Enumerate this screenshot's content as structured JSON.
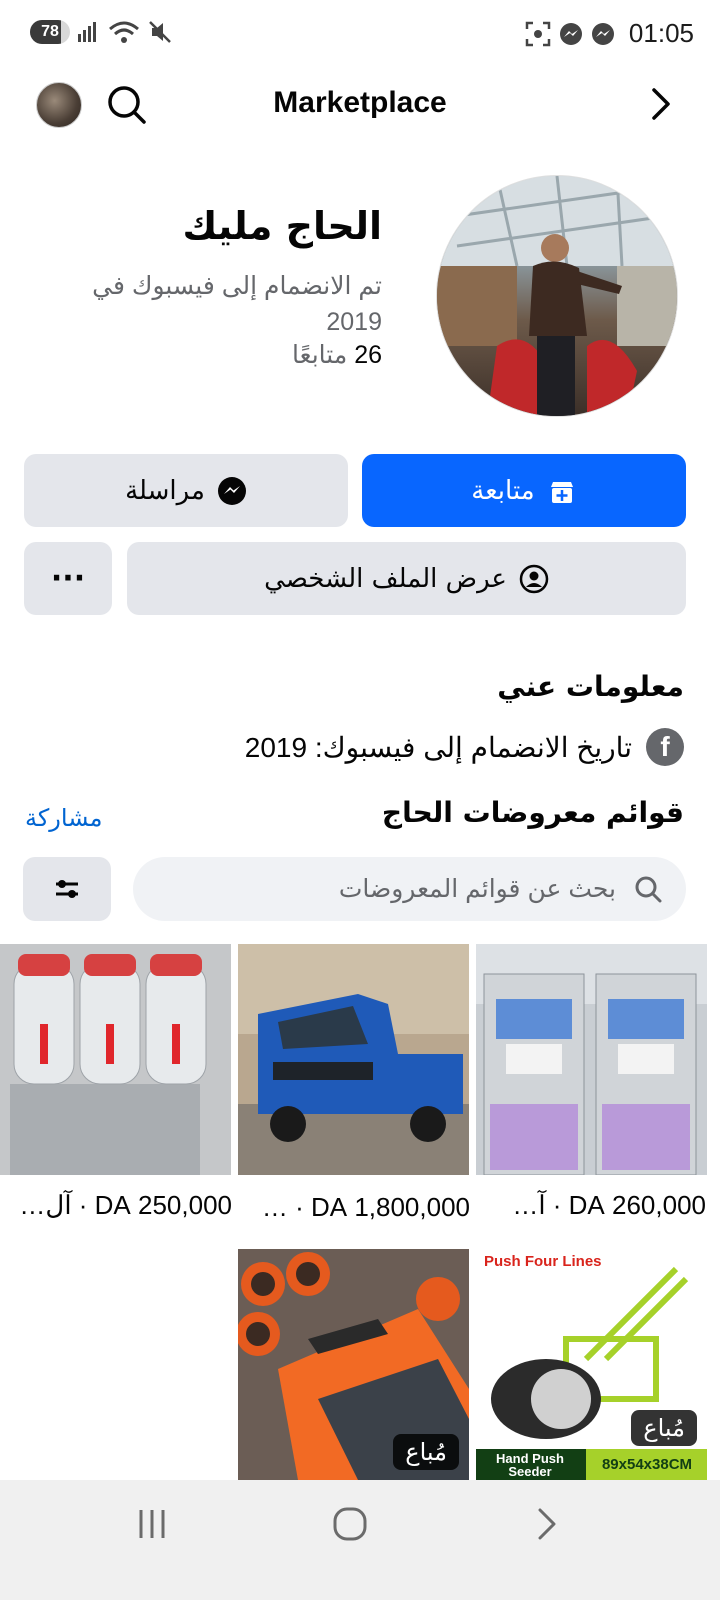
{
  "status_bar": {
    "battery": "78",
    "battery_level": 0.78,
    "time": "01:05"
  },
  "header": {
    "title": "Marketplace",
    "icons": [
      "avatar",
      "search-icon",
      "chevron-right-icon"
    ]
  },
  "profile": {
    "name": "الحاج مليك",
    "joined_line1": "تم الانضمام إلى فيسبوك في",
    "joined_line2": "2019",
    "followers_count": "26",
    "followers_label": "متابعًا"
  },
  "actions": {
    "follow_label": "متابعة",
    "message_label": "مراسلة",
    "view_profile_label": "عرض الملف الشخصي",
    "more_label": "···"
  },
  "about": {
    "title": "معلومات عني",
    "joined_text": "تاريخ الانضمام إلى فيسبوك: 2019"
  },
  "listings": {
    "title": "قوائم معروضات الحاج",
    "share_label": "مشاركة",
    "search_placeholder": "بحث عن قوائم المعروضات",
    "items": [
      {
        "price_text": "260,000 DA · آ…",
        "photo": "soft-serve ice cream machines"
      },
      {
        "price_text": "1,800,000 DA · …",
        "photo": "blue pickup truck"
      },
      {
        "price_text": "250,000 DA · آل…",
        "photo": "slush drink dispenser"
      },
      {
        "photo": "push seeder",
        "banner_top": "Push Four Lines",
        "banner_bottom_left": "Hand Push Seeder",
        "banner_bottom_right": "89x54x38CM",
        "badge": "مُباع"
      },
      {
        "photo": "orange pvc pipes",
        "badge": "مُباع"
      }
    ]
  },
  "colors": {
    "accent": "#0866ff",
    "button_gray": "#e4e6eb",
    "secondary_text": "#65676b",
    "link": "#0064d1"
  }
}
